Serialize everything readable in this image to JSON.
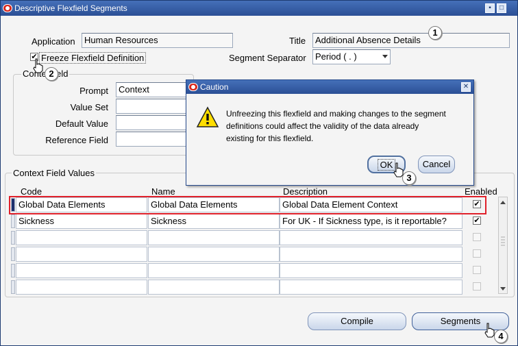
{
  "window": {
    "title": "Descriptive Flexfield Segments",
    "minimize": "▪",
    "maximize": "□"
  },
  "header": {
    "application_label": "Application",
    "application_value": "Human Resources",
    "title_label": "Title",
    "title_value": "Additional Absence Details",
    "freeze_label": "Freeze Flexfield Definition",
    "freeze_checked": "✔",
    "separator_label": "Segment Separator",
    "separator_value": "Period ( . )"
  },
  "context_field": {
    "group_title": "Conte  Field",
    "prompt_label": "Prompt",
    "prompt_value": "Context",
    "value_set_label": "Value Set",
    "default_value_label": "Default Value",
    "reference_field_label": "Reference Field"
  },
  "context_values": {
    "group_title": "Context Field Values",
    "columns": {
      "code": "Code",
      "name": "Name",
      "description": "Description",
      "enabled": "Enabled"
    },
    "rows": [
      {
        "code": "Global Data Elements",
        "name": "Global Data Elements",
        "description": "Global Data Element Context",
        "enabled": "✔"
      },
      {
        "code": "Sickness",
        "name": "Sickness",
        "description": "For UK - If Sickness type, is it reportable?",
        "enabled": "✔"
      },
      {
        "code": "",
        "name": "",
        "description": "",
        "enabled": ""
      },
      {
        "code": "",
        "name": "",
        "description": "",
        "enabled": ""
      },
      {
        "code": "",
        "name": "",
        "description": "",
        "enabled": ""
      },
      {
        "code": "",
        "name": "",
        "description": "",
        "enabled": ""
      }
    ]
  },
  "buttons": {
    "compile": "Compile",
    "segments": "Segments"
  },
  "dialog": {
    "title": "Caution",
    "close": "✕",
    "message_line1": "Unfreezing this flexfield and making changes to the segment",
    "message_line2": "definitions could affect the validity of the data already",
    "message_line3": "existing for this flexfield.",
    "ok_label": "OK",
    "cancel_label": "Cancel"
  },
  "callouts": {
    "c1": "1",
    "c2": "2",
    "c3": "3",
    "c4": "4"
  },
  "icons": {
    "app_icon": "oracle-icon",
    "warning": "warning-icon",
    "pointer": "hand-pointer-icon"
  },
  "colors": {
    "titlebar": "#2b4f95",
    "highlight": "#e0202a",
    "row_indicator": "#1d2f6c"
  }
}
